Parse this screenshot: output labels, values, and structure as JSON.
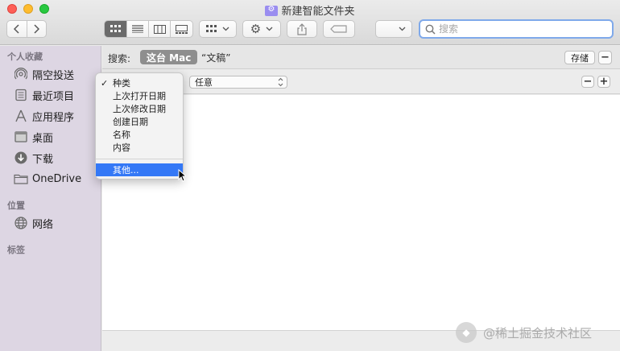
{
  "window": {
    "title": "新建智能文件夹"
  },
  "toolbar": {
    "search_placeholder": "搜索",
    "view_icons": [
      "icon-view-icon",
      "list-view-icon",
      "column-view-icon",
      "gallery-view-icon"
    ]
  },
  "sidebar": {
    "favorites_header": "个人收藏",
    "favorites": [
      {
        "label": "隔空投送",
        "icon": "airdrop-icon"
      },
      {
        "label": "最近项目",
        "icon": "recents-icon"
      },
      {
        "label": "应用程序",
        "icon": "applications-icon"
      },
      {
        "label": "桌面",
        "icon": "desktop-icon"
      },
      {
        "label": "下载",
        "icon": "downloads-icon"
      },
      {
        "label": "OneDrive",
        "icon": "folder-icon"
      }
    ],
    "locations_header": "位置",
    "locations": [
      {
        "label": "网络",
        "icon": "network-icon"
      }
    ],
    "tags_header": "标签"
  },
  "search_scope": {
    "label": "搜索:",
    "active": "这台 Mac",
    "other": "“文稿”",
    "save_label": "存储"
  },
  "criteria": {
    "value_select": "任意"
  },
  "menu": {
    "items": [
      "种类",
      "上次打开日期",
      "上次修改日期",
      "创建日期",
      "名称",
      "内容"
    ],
    "checked_index": 0,
    "other": "其他..."
  },
  "watermark": {
    "text": "@稀土掘金技术社区"
  }
}
